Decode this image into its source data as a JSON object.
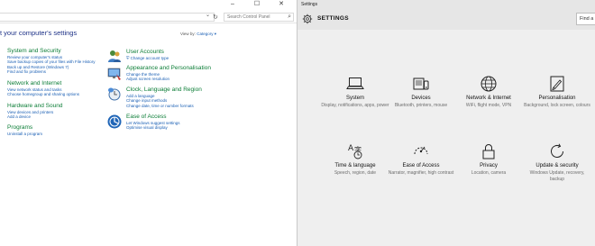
{
  "control_panel": {
    "search_placeholder": "Search Control Panel",
    "heading": "Adjust your computer's settings",
    "heading_visible": "t your computer's settings",
    "view_by_label": "View by:",
    "view_by_value": "Category ▾",
    "left_categories": [
      {
        "title": "System and Security",
        "links": [
          "Review your computer's status",
          "Save backup copies of your files with File History",
          "Back up and Restore (Windows 7)",
          "Find and fix problems"
        ]
      },
      {
        "title": "Network and Internet",
        "links": [
          "View network status and tasks",
          "Choose homegroup and sharing options"
        ]
      },
      {
        "title": "Hardware and Sound",
        "links": [
          "View devices and printers",
          "Add a device"
        ]
      },
      {
        "title": "Programs",
        "links": [
          "Uninstall a program"
        ]
      }
    ],
    "right_categories": [
      {
        "title": "User Accounts",
        "links": [
          "Change account type"
        ]
      },
      {
        "title": "Appearance and Personalisation",
        "links": [
          "Change the theme",
          "Adjust screen resolution"
        ]
      },
      {
        "title": "Clock, Language and Region",
        "links": [
          "Add a language",
          "Change input methods",
          "Change date, time or number formats"
        ]
      },
      {
        "title": "Ease of Access",
        "links": [
          "Let Windows suggest settings",
          "Optimise visual display"
        ]
      }
    ]
  },
  "settings": {
    "app_title": "Settings",
    "heading": "SETTINGS",
    "find_placeholder": "Find a",
    "tiles": [
      {
        "title": "System",
        "desc": "Display, notifications, apps, power",
        "icon": "laptop-icon"
      },
      {
        "title": "Devices",
        "desc": "Bluetooth, printers, mouse",
        "icon": "devices-icon"
      },
      {
        "title": "Network & Internet",
        "desc": "WiFi, flight mode, VPN",
        "icon": "globe-icon"
      },
      {
        "title": "Personalisation",
        "desc": "Background, lock screen, colours",
        "icon": "paint-icon"
      },
      {
        "title": "Time & language",
        "desc": "Speech, region, date",
        "icon": "time-language-icon"
      },
      {
        "title": "Ease of Access",
        "desc": "Narrator, magnifier, high contrast",
        "icon": "ease-of-access-icon"
      },
      {
        "title": "Privacy",
        "desc": "Location, camera",
        "icon": "lock-icon"
      },
      {
        "title": "Update & security",
        "desc": "Windows Update, recovery, backup",
        "icon": "update-icon"
      }
    ]
  }
}
